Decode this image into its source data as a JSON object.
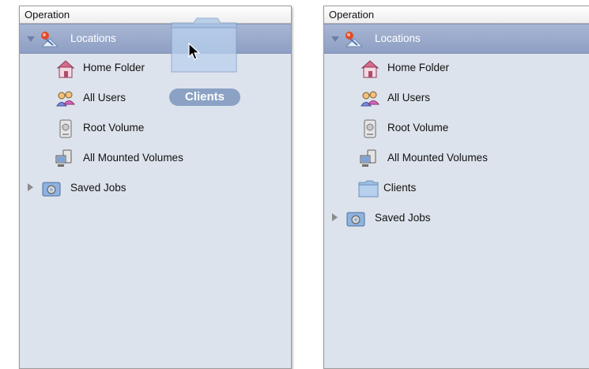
{
  "left_panel": {
    "header": "Operation",
    "locations": "Locations",
    "items": [
      "Home Folder",
      "All Users",
      "Root Volume",
      "All Mounted Volumes"
    ],
    "saved_jobs": "Saved Jobs",
    "drag_label": "Clients"
  },
  "right_panel": {
    "header": "Operation",
    "locations": "Locations",
    "items": [
      "Home Folder",
      "All Users",
      "Root Volume",
      "All Mounted Volumes",
      "Clients"
    ],
    "saved_jobs": "Saved Jobs"
  },
  "colors": {
    "panel_bg": "#dde3ec",
    "selection": "#98a8ca",
    "folder": "#9fc0e6"
  }
}
